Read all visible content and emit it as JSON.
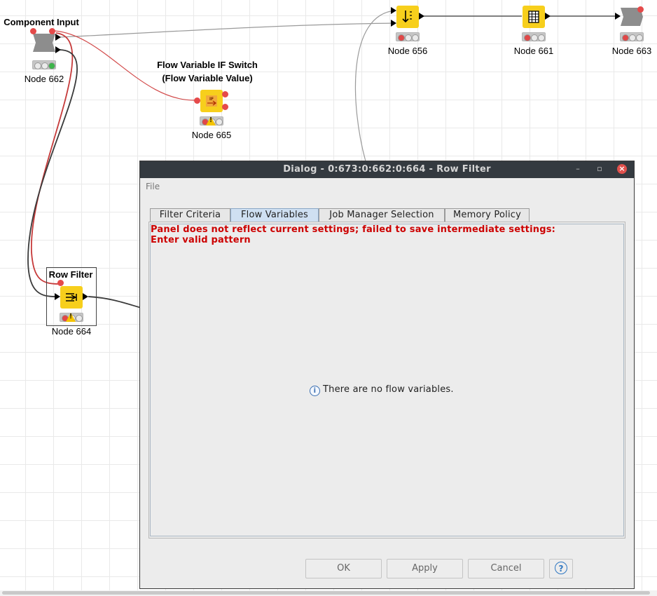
{
  "canvas": {
    "nodes": [
      {
        "id": "node-662",
        "title": "Component Input",
        "label": "Node 662"
      },
      {
        "id": "node-665",
        "title_line1": "Flow Variable IF Switch",
        "title_line2": "(Flow Variable Value)",
        "label": "Node 665"
      },
      {
        "id": "node-664",
        "title": "Row Filter",
        "label": "Node 664"
      },
      {
        "id": "node-656",
        "label": "Node 656"
      },
      {
        "id": "node-661",
        "label": "Node 661"
      },
      {
        "id": "node-663",
        "label": "Node 663"
      }
    ],
    "icon_names": {
      "node-662": "component-input-icon",
      "node-665": "if-switch-icon",
      "node-664": "row-filter-icon",
      "node-656": "sorter-icon",
      "node-661": "table-view-icon",
      "node-663": "component-output-icon"
    },
    "colors": {
      "node_yellow": "#f7cf1c",
      "flow_variable_wire": "#d24a4a",
      "data_wire": "#3a3a3a",
      "status_green": "#3cb54a",
      "status_red": "#e04848",
      "status_warning": "#f5c400"
    }
  },
  "dialog": {
    "title": "Dialog - 0:673:0:662:0:664 - Row Filter",
    "menu": {
      "file": "File"
    },
    "window_buttons": {
      "minimize": "–",
      "maximize": "▫",
      "close": "×"
    },
    "tabs": [
      {
        "label": "Filter Criteria",
        "active": false
      },
      {
        "label": "Flow Variables",
        "active": true
      },
      {
        "label": "Job Manager Selection",
        "active": false
      },
      {
        "label": "Memory Policy",
        "active": false
      }
    ],
    "error_line1": "Panel does not reflect current settings; failed to save intermediate settings:",
    "error_line2": "Enter valid pattern",
    "info_message": "There are no flow variables.",
    "buttons": {
      "ok": "OK",
      "apply": "Apply",
      "cancel": "Cancel",
      "help": "?"
    },
    "colors": {
      "titlebar": "#343a40",
      "error_text": "#cc0000",
      "active_tab": "#cfe0f2"
    }
  }
}
